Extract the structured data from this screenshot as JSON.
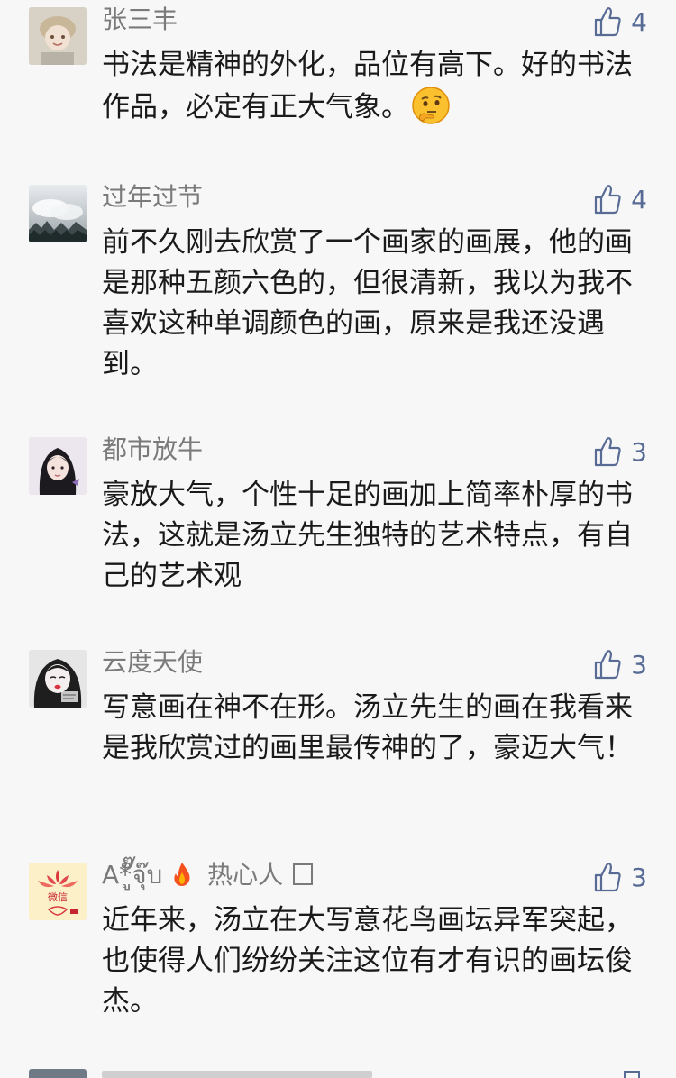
{
  "comments": [
    {
      "name": "张三丰",
      "badge": "",
      "likes": "4",
      "text": "书法是精神的外化，品位有高下。好的书法作品，必定有正大气象。",
      "emoji": "thinking-face"
    },
    {
      "name": "过年过节",
      "badge": "",
      "likes": "4",
      "text": "前不久刚去欣赏了一个画家的画展，他的画是那种五颜六色的，但很清新，我以为我不喜欢这种单调颜色的画，原来是我还没遇到。"
    },
    {
      "name": "都市放牛",
      "badge": "",
      "likes": "3",
      "text": "豪放大气，个性十足的画加上简率朴厚的书法，这就是汤立先生独特的艺术特点，有自己的艺术观"
    },
    {
      "name": "云度天使",
      "badge": "",
      "likes": "3",
      "text": "写意画在神不在形。汤立先生的画在我看来是我欣赏过的画里最传神的了，豪迈大气！"
    },
    {
      "name": "A*ู๊ั๊จุ๊บ",
      "badge": "热心人",
      "likes": "3",
      "text": "近年来，汤立在大写意花鸟画坛异军突起，也使得人们纷纷关注这位有才有识的画坛俊杰。",
      "avatar_label": "微信"
    }
  ],
  "icons": {
    "like": "thumbs-up-icon",
    "fire": "fire-icon",
    "emoji": "thinking-face-icon"
  },
  "colors": {
    "accent": "#576b95",
    "name": "#7a7a7a",
    "text": "#1a1a1a",
    "background": "#f7f7f7"
  }
}
